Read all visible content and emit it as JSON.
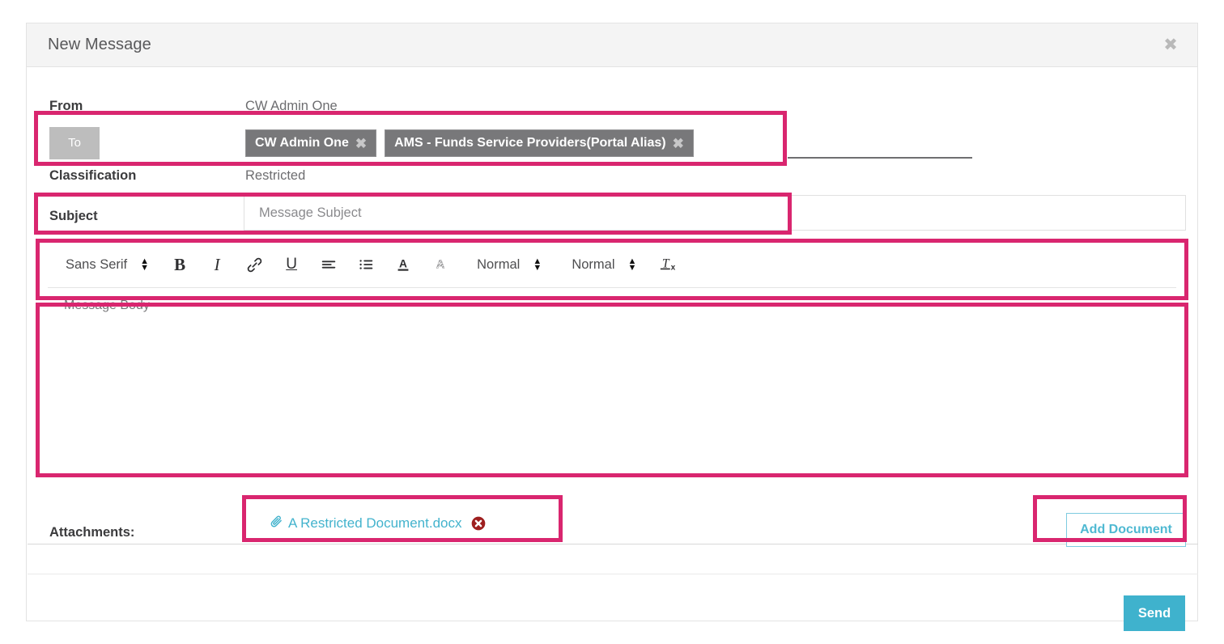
{
  "dialog": {
    "title": "New Message",
    "close_icon": "close-icon"
  },
  "fields": {
    "from_label": "From",
    "from_value": "CW Admin One",
    "to_label": "To",
    "classification_label": "Classification",
    "classification_value": "Restricted",
    "subject_label": "Subject",
    "subject_value": "",
    "subject_placeholder": "Message Subject"
  },
  "recipients": [
    {
      "name": "CW Admin One",
      "remove_icon": "remove-chip-icon"
    },
    {
      "name": "AMS - Funds Service Providers(Portal Alias)",
      "remove_icon": "remove-chip-icon"
    }
  ],
  "editor": {
    "font_family": "Sans Serif",
    "size_value": "Normal",
    "style_value": "Normal",
    "body_placeholder": "Message Body",
    "body_value": "",
    "tools": [
      {
        "name": "bold",
        "glyph": "B"
      },
      {
        "name": "italic",
        "glyph": "I"
      },
      {
        "name": "link",
        "glyph": "link-icon"
      },
      {
        "name": "underline",
        "glyph": "U"
      },
      {
        "name": "align-left",
        "glyph": "align-left-icon"
      },
      {
        "name": "bullet-list",
        "glyph": "bullet-list-icon"
      },
      {
        "name": "font-color",
        "glyph": "font-color-icon"
      },
      {
        "name": "highlight-color",
        "glyph": "highlight-icon"
      },
      {
        "name": "clear-formatting",
        "glyph": "clear-format-icon"
      }
    ]
  },
  "attachments": {
    "label": "Attachments:",
    "items": [
      {
        "filename": "A Restricted Document.docx",
        "clip_icon": "paperclip-icon",
        "remove_icon": "remove-attachment-icon"
      }
    ],
    "add_button": "Add Document"
  },
  "footer": {
    "send_label": "Send"
  },
  "colors": {
    "annotation": "#d9266f",
    "accent_teal": "#3fb2cd",
    "chip_gray": "#78787a",
    "remove_red": "#a02020"
  }
}
